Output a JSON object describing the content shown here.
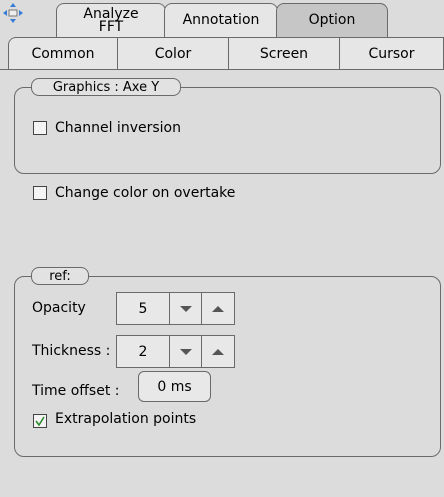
{
  "tabs": {
    "top": [
      {
        "label": "Analyze\nFFT"
      },
      {
        "label": "Annotation"
      },
      {
        "label": "Option"
      }
    ],
    "sub": [
      {
        "label": "Common"
      },
      {
        "label": "Color"
      },
      {
        "label": "Screen"
      },
      {
        "label": "Cursor"
      }
    ]
  },
  "graphics_group": {
    "title": "Graphics : Axe Y",
    "channel_inversion": {
      "label": "Channel inversion",
      "checked": false
    }
  },
  "change_color": {
    "label": "Change color on overtake",
    "checked": false
  },
  "ref_group": {
    "title": "ref:",
    "opacity": {
      "label": "Opacity",
      "value": "5"
    },
    "thickness": {
      "label": "Thickness :",
      "value": "2"
    },
    "time_offset": {
      "label": "Time offset :",
      "value": "0 ms"
    },
    "extrapolation": {
      "label": "Extrapolation points",
      "checked": true
    }
  }
}
